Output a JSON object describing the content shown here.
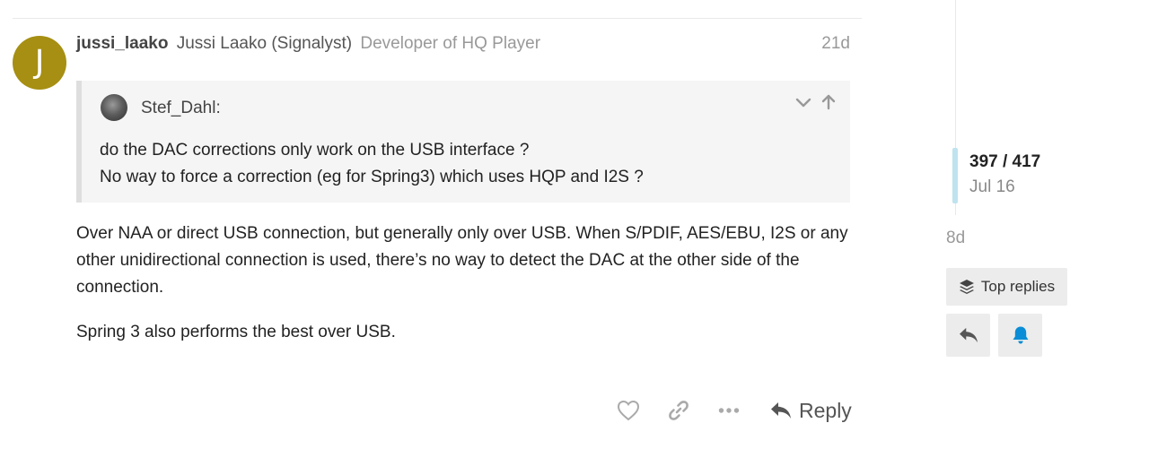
{
  "post": {
    "avatar_letter": "J",
    "username": "jussi_laako",
    "full_name": "Jussi Laako (Signalyst)",
    "user_title": "Developer of HQ Player",
    "date": "21d",
    "quote": {
      "author": "Stef_Dahl:",
      "lines": [
        "do the DAC corrections only work on the USB interface ?",
        "No way to force a correction (eg for Spring3) which uses HQP and I2S ?"
      ],
      "icons": [
        "chevron-down-icon",
        "arrow-up-icon"
      ]
    },
    "paragraphs": [
      "Over NAA or direct USB connection, but generally only over USB. When S/PDIF, AES/EBU, I2S or any other unidirectional connection is used, there’s no way to detect the DAC at the other side of the connection.",
      "Spring 3 also performs the best over USB."
    ],
    "actions": {
      "icons": [
        "heart-icon",
        "link-icon",
        "more-icon",
        "reply-icon"
      ],
      "reply_label": "Reply"
    }
  },
  "timeline": {
    "position": "397 / 417",
    "date": "Jul 16",
    "ago": "8d",
    "top_replies_label": "Top replies",
    "icons": [
      "layers-icon",
      "reply-icon",
      "bell-icon"
    ]
  },
  "colors": {
    "avatar_bg": "#a68f12",
    "quote_bg": "#f5f5f5",
    "timeline_handle": "#bfe3ef",
    "bell": "#0a8dd6"
  }
}
